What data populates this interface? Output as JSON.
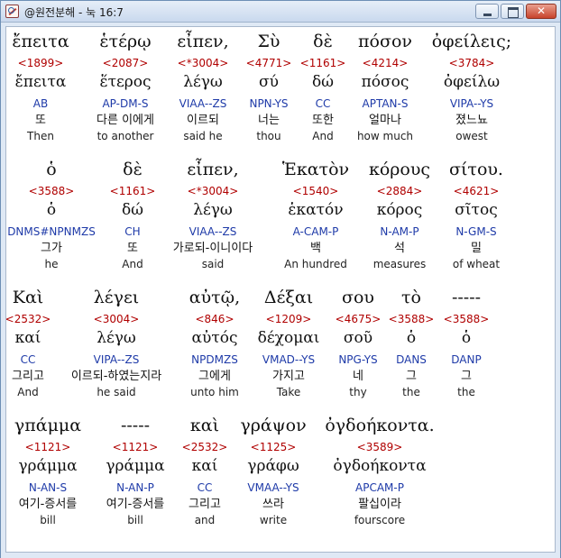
{
  "window": {
    "title": "@원전분해 - 눅 16:7"
  },
  "rows": [
    {
      "words": [
        {
          "greek": "ἔπειτα",
          "strong": "<1899>",
          "lemma": "ἔπειτα",
          "parse": "AB",
          "korean": "또",
          "english": "Then"
        },
        {
          "greek": "ἑτέρῳ",
          "strong": "<2087>",
          "lemma": "ἕτερος",
          "parse": "AP-DM-S",
          "korean": "다른 이에게",
          "english": "to another"
        },
        {
          "greek": "εἶπεν,",
          "strong": "<*3004>",
          "lemma": "λέγω",
          "parse": "VIAA--ZS",
          "korean": "이르되",
          "english": "said he"
        },
        {
          "greek": "Σὺ",
          "strong": "<4771>",
          "lemma": "σύ",
          "parse": "NPN-YS",
          "korean": "너는",
          "english": "thou"
        },
        {
          "greek": "δὲ",
          "strong": "<1161>",
          "lemma": "δώ",
          "parse": "CC",
          "korean": "또한",
          "english": "And"
        },
        {
          "greek": "πόσον",
          "strong": "<4214>",
          "lemma": "πόσος",
          "parse": "APTAN-S",
          "korean": "얼마나",
          "english": "how much"
        },
        {
          "greek": "ὀφείλεις;",
          "strong": "<3784>",
          "lemma": "ὀφείλω",
          "parse": "VIPA--YS",
          "korean": "졌느뇨",
          "english": "owest"
        }
      ]
    },
    {
      "words": [
        {
          "greek": "ὁ",
          "strong": "<3588>",
          "lemma": "ὁ",
          "parse": "DNMS#NPNMZS",
          "korean": "그가",
          "english": "he"
        },
        {
          "greek": "δὲ",
          "strong": "<1161>",
          "lemma": "δώ",
          "parse": "CH",
          "korean": "또",
          "english": "And"
        },
        {
          "greek": "εἶπεν,",
          "strong": "<*3004>",
          "lemma": "λέγω",
          "parse": "VIAA--ZS",
          "korean": "가로되-이니이다",
          "english": "said"
        },
        {
          "greek": "Ἑκατὸν",
          "strong": "<1540>",
          "lemma": "ἑκατόν",
          "parse": "A-CAM-P",
          "korean": "백",
          "english": "An hundred"
        },
        {
          "greek": "κόρους",
          "strong": "<2884>",
          "lemma": "κόρος",
          "parse": "N-AM-P",
          "korean": "석",
          "english": "measures"
        },
        {
          "greek": "σίτου.",
          "strong": "<4621>",
          "lemma": "σῖτος",
          "parse": "N-GM-S",
          "korean": "밀",
          "english": "of wheat"
        }
      ]
    },
    {
      "words": [
        {
          "greek": "Καὶ",
          "strong": "<2532>",
          "lemma": "καί",
          "parse": "CC",
          "korean": "그리고",
          "english": "And"
        },
        {
          "greek": "λέγει",
          "strong": "<3004>",
          "lemma": "λέγω",
          "parse": "VIPA--ZS",
          "korean": "이르되-하였는지라",
          "english": "he said"
        },
        {
          "greek": "αὐτῷ,",
          "strong": "<846>",
          "lemma": "αὐτός",
          "parse": "NPDMZS",
          "korean": "그에게",
          "english": "unto him"
        },
        {
          "greek": "Δέξαι",
          "strong": "<1209>",
          "lemma": "δέχομαι",
          "parse": "VMAD--YS",
          "korean": "가지고",
          "english": "Take"
        },
        {
          "greek": "σου",
          "strong": "<4675>",
          "lemma": "σοῦ",
          "parse": "NPG-YS",
          "korean": "네",
          "english": "thy"
        },
        {
          "greek": "τὸ",
          "strong": "<3588>",
          "lemma": "ὁ",
          "parse": "DANS",
          "korean": "그",
          "english": "the"
        },
        {
          "greek": "-----",
          "strong": "<3588>",
          "lemma": "ὁ",
          "parse": "DANP",
          "korean": "그",
          "english": "the"
        }
      ]
    },
    {
      "words": [
        {
          "greek": "γπάμμα",
          "strong": "<1121>",
          "lemma": "γράμμα",
          "parse": "N-AN-S",
          "korean": "여기-증서를",
          "english": "bill"
        },
        {
          "greek": "-----",
          "strong": "<1121>",
          "lemma": "γράμμα",
          "parse": "N-AN-P",
          "korean": "여기-증서를",
          "english": "bill"
        },
        {
          "greek": "καὶ",
          "strong": "<2532>",
          "lemma": "καί",
          "parse": "CC",
          "korean": "그리고",
          "english": "and"
        },
        {
          "greek": "γράψον",
          "strong": "<1125>",
          "lemma": "γράφω",
          "parse": "VMAA--YS",
          "korean": "쓰라",
          "english": "write"
        },
        {
          "greek": "ὀγδοήκοντα.",
          "strong": "<3589>",
          "lemma": "ὀγδοήκοντα",
          "parse": "APCAM-P",
          "korean": "팔십이라",
          "english": "fourscore"
        }
      ]
    }
  ]
}
